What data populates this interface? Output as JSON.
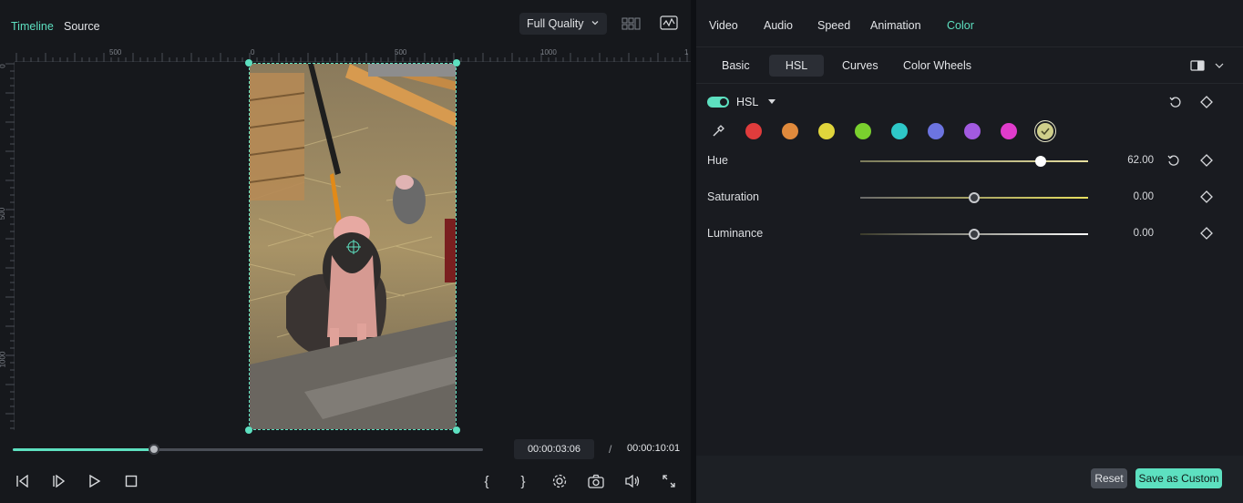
{
  "preview": {
    "tabs": [
      "Timeline",
      "Source"
    ],
    "active_tab": "Timeline",
    "quality": "Full Quality",
    "ruler_top_labels": [
      "500",
      "0",
      "500",
      "1000",
      "1"
    ],
    "ruler_left_labels": [
      "0",
      "500",
      "1000"
    ],
    "playhead_progress": 0.3,
    "current_time": "00:00:03:06",
    "separator": "/",
    "total_time": "00:00:10:01",
    "mark_in": "{",
    "mark_out": "}"
  },
  "panel": {
    "tabs": [
      "Video",
      "Audio",
      "Speed",
      "Animation",
      "Color"
    ],
    "active_tab": "Color",
    "subtabs": [
      "Basic",
      "HSL",
      "Curves",
      "Color Wheels"
    ],
    "active_subtab": "HSL",
    "hsl_section_label": "HSL",
    "hsl_enabled": true,
    "swatches": [
      {
        "name": "red",
        "color": "#e03c3c"
      },
      {
        "name": "orange",
        "color": "#e08a3c"
      },
      {
        "name": "yellow",
        "color": "#e0d53c"
      },
      {
        "name": "green",
        "color": "#7ad02e"
      },
      {
        "name": "cyan",
        "color": "#2ec8c8"
      },
      {
        "name": "blue",
        "color": "#6c74e0"
      },
      {
        "name": "purple",
        "color": "#a25ae0"
      },
      {
        "name": "magenta",
        "color": "#e03ccc"
      },
      {
        "name": "selected",
        "color": "#cfcf8a"
      }
    ],
    "params": [
      {
        "label": "Hue",
        "value": "62.00",
        "position": 0.79
      },
      {
        "label": "Saturation",
        "value": "0.00",
        "position": 0.5
      },
      {
        "label": "Luminance",
        "value": "0.00",
        "position": 0.5
      }
    ],
    "reset_label": "Reset",
    "save_label": "Save as Custom"
  },
  "colors": {
    "accent": "#5de0c0",
    "background": "#16181c"
  }
}
